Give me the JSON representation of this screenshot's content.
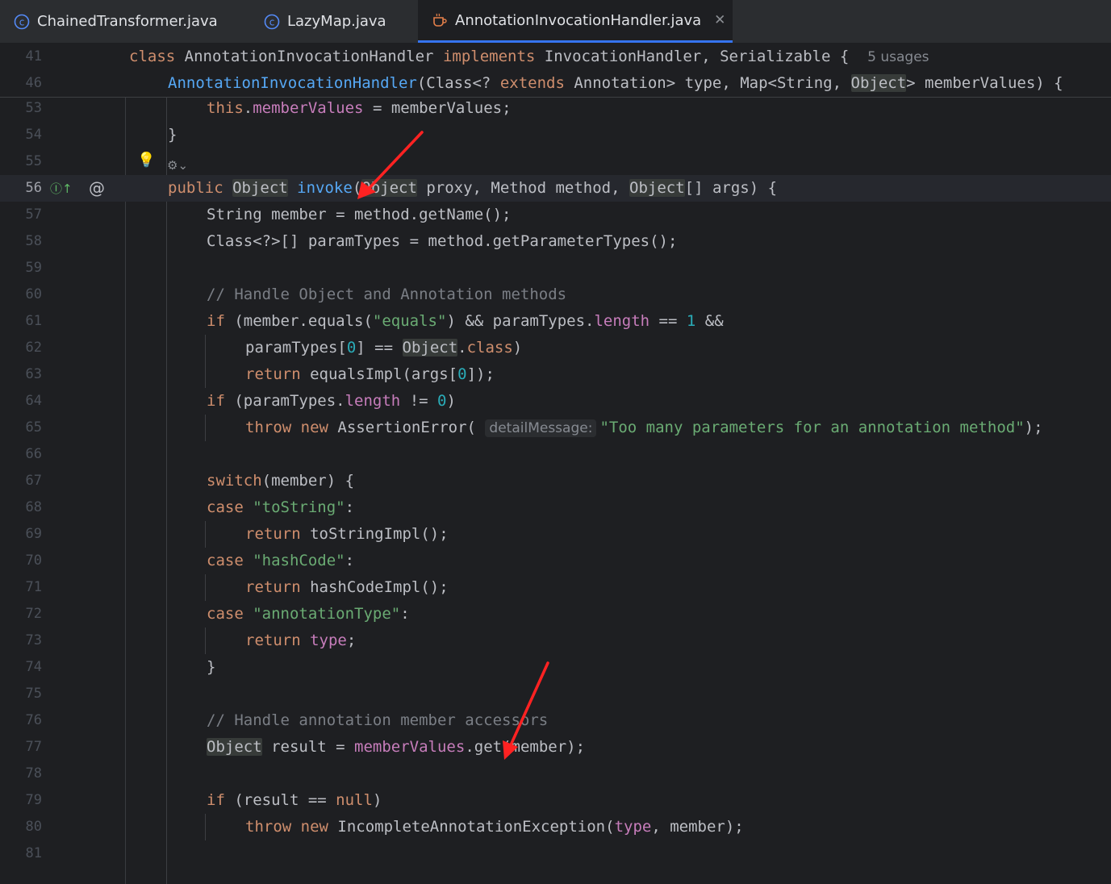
{
  "tabs": [
    {
      "label": "ChainedTransformer.java",
      "icon": "class-icon",
      "active": false
    },
    {
      "label": "LazyMap.java",
      "icon": "class-icon",
      "active": false
    },
    {
      "label": "AnnotationInvocationHandler.java",
      "icon": "java-file-icon",
      "active": true
    }
  ],
  "close_glyph": "✕",
  "gutter": {
    "override_icon": "implementing-method-icon",
    "override_glyph": "Ⓘ↑",
    "annotation_icon": "at-icon",
    "annotation_glyph": "@",
    "bulb_icon": "lightbulb-icon",
    "bulb_glyph": "💡",
    "gear_icon": "ai-actions-icon",
    "gear_glyph": "⚙⌄"
  },
  "colors": {
    "keyword": "#cf8e6d",
    "method": "#56a8f5",
    "field": "#c77dbb",
    "string": "#6aab73",
    "number": "#2aacb8",
    "comment": "#7a7e85",
    "text": "#bcbec4",
    "arrow": "#ff2222",
    "tab_active_underline": "#3574f0"
  },
  "sticky_lines": [
    {
      "n": "41",
      "i": 1,
      "t": [
        [
          "kw",
          "class "
        ],
        [
          "",
          "AnnotationInvocationHandler "
        ],
        [
          "kw",
          "implements "
        ],
        [
          "",
          "InvocationHandler, Serializable {  "
        ],
        [
          "usages",
          "5 usages"
        ]
      ]
    },
    {
      "n": "46",
      "i": 2,
      "t": [
        [
          "fn",
          "AnnotationInvocationHandler"
        ],
        [
          "",
          "(Class<? "
        ],
        [
          "kw",
          "extends "
        ],
        [
          "",
          "Annotation> type, Map<String, "
        ],
        [
          "hl",
          "Object"
        ],
        [
          "",
          "> memberValues) {"
        ]
      ]
    }
  ],
  "code_lines": [
    {
      "n": "53",
      "i": 3,
      "t": [
        [
          "kw",
          "this"
        ],
        [
          "",
          "."
        ],
        [
          "fld",
          "memberValues"
        ],
        [
          "",
          " = memberValues;"
        ]
      ]
    },
    {
      "n": "54",
      "i": 2,
      "t": [
        [
          "",
          "}"
        ]
      ]
    },
    {
      "n": "55",
      "i": 0,
      "t": []
    },
    {
      "n": "56",
      "i": 2,
      "t": [
        [
          "kw",
          "public "
        ],
        [
          "hl",
          "Object"
        ],
        [
          "",
          " "
        ],
        [
          "fn",
          "invoke"
        ],
        [
          "",
          "("
        ],
        [
          "hl",
          "Object"
        ],
        [
          "",
          " proxy, Method method, "
        ],
        [
          "hl",
          "Object"
        ],
        [
          "",
          "[] args) {"
        ]
      ]
    },
    {
      "n": "57",
      "i": 3,
      "t": [
        [
          "",
          "String member = method.getName();"
        ]
      ]
    },
    {
      "n": "58",
      "i": 3,
      "t": [
        [
          "",
          "Class<?>[] paramTypes = method.getParameterTypes();"
        ]
      ]
    },
    {
      "n": "59",
      "i": 0,
      "t": []
    },
    {
      "n": "60",
      "i": 3,
      "t": [
        [
          "cmt",
          "// Handle Object and Annotation methods"
        ]
      ]
    },
    {
      "n": "61",
      "i": 3,
      "t": [
        [
          "kw",
          "if "
        ],
        [
          "",
          "(member.equals("
        ],
        [
          "str",
          "\"equals\""
        ],
        [
          "",
          ") && paramTypes."
        ],
        [
          "fld",
          "length"
        ],
        [
          "",
          " == "
        ],
        [
          "num",
          "1"
        ],
        [
          "",
          " &&"
        ]
      ]
    },
    {
      "n": "62",
      "i": 4,
      "t": [
        [
          "",
          "paramTypes["
        ],
        [
          "num",
          "0"
        ],
        [
          "",
          "] == "
        ],
        [
          "hl",
          "Object"
        ],
        [
          "",
          "."
        ],
        [
          "kw",
          "class"
        ],
        [
          "",
          ")"
        ]
      ]
    },
    {
      "n": "63",
      "i": 4,
      "t": [
        [
          "kw",
          "return "
        ],
        [
          "",
          "equalsImpl(args["
        ],
        [
          "num",
          "0"
        ],
        [
          "",
          "]);"
        ]
      ]
    },
    {
      "n": "64",
      "i": 3,
      "t": [
        [
          "kw",
          "if "
        ],
        [
          "",
          "(paramTypes."
        ],
        [
          "fld",
          "length"
        ],
        [
          "",
          " != "
        ],
        [
          "num",
          "0"
        ],
        [
          "",
          ")"
        ]
      ]
    },
    {
      "n": "65",
      "i": 4,
      "t": [
        [
          "kw",
          "throw new "
        ],
        [
          "",
          "AssertionError( "
        ],
        [
          "hint",
          "detailMessage:"
        ],
        [
          "str",
          "\"Too many parameters for an annotation method\""
        ],
        [
          "",
          ");"
        ]
      ]
    },
    {
      "n": "66",
      "i": 0,
      "t": []
    },
    {
      "n": "67",
      "i": 3,
      "t": [
        [
          "kw",
          "switch"
        ],
        [
          "",
          "(member) {"
        ]
      ]
    },
    {
      "n": "68",
      "i": 3,
      "t": [
        [
          "kw",
          "case "
        ],
        [
          "str",
          "\"toString\""
        ],
        [
          "",
          ":"
        ]
      ]
    },
    {
      "n": "69",
      "i": 4,
      "t": [
        [
          "kw",
          "return "
        ],
        [
          "",
          "toStringImpl();"
        ]
      ]
    },
    {
      "n": "70",
      "i": 3,
      "t": [
        [
          "kw",
          "case "
        ],
        [
          "str",
          "\"hashCode\""
        ],
        [
          "",
          ":"
        ]
      ]
    },
    {
      "n": "71",
      "i": 4,
      "t": [
        [
          "kw",
          "return "
        ],
        [
          "",
          "hashCodeImpl();"
        ]
      ]
    },
    {
      "n": "72",
      "i": 3,
      "t": [
        [
          "kw",
          "case "
        ],
        [
          "str",
          "\"annotationType\""
        ],
        [
          "",
          ":"
        ]
      ]
    },
    {
      "n": "73",
      "i": 4,
      "t": [
        [
          "kw",
          "return "
        ],
        [
          "fld",
          "type"
        ],
        [
          "",
          ";"
        ]
      ]
    },
    {
      "n": "74",
      "i": 3,
      "t": [
        [
          "",
          "}"
        ]
      ]
    },
    {
      "n": "75",
      "i": 0,
      "t": []
    },
    {
      "n": "76",
      "i": 3,
      "t": [
        [
          "cmt",
          "// Handle annotation member accessors"
        ]
      ]
    },
    {
      "n": "77",
      "i": 3,
      "t": [
        [
          "hl",
          "Object"
        ],
        [
          "",
          " result = "
        ],
        [
          "fld",
          "memberValues"
        ],
        [
          "",
          ".get(member);"
        ]
      ]
    },
    {
      "n": "78",
      "i": 0,
      "t": []
    },
    {
      "n": "79",
      "i": 3,
      "t": [
        [
          "kw",
          "if "
        ],
        [
          "",
          "(result == "
        ],
        [
          "kw",
          "null"
        ],
        [
          "",
          ")"
        ]
      ]
    },
    {
      "n": "80",
      "i": 4,
      "t": [
        [
          "kw",
          "throw new "
        ],
        [
          "",
          "IncompleteAnnotationException("
        ],
        [
          "fld",
          "type"
        ],
        [
          "",
          ", member);"
        ]
      ]
    },
    {
      "n": "81",
      "i": 0,
      "t": []
    }
  ]
}
